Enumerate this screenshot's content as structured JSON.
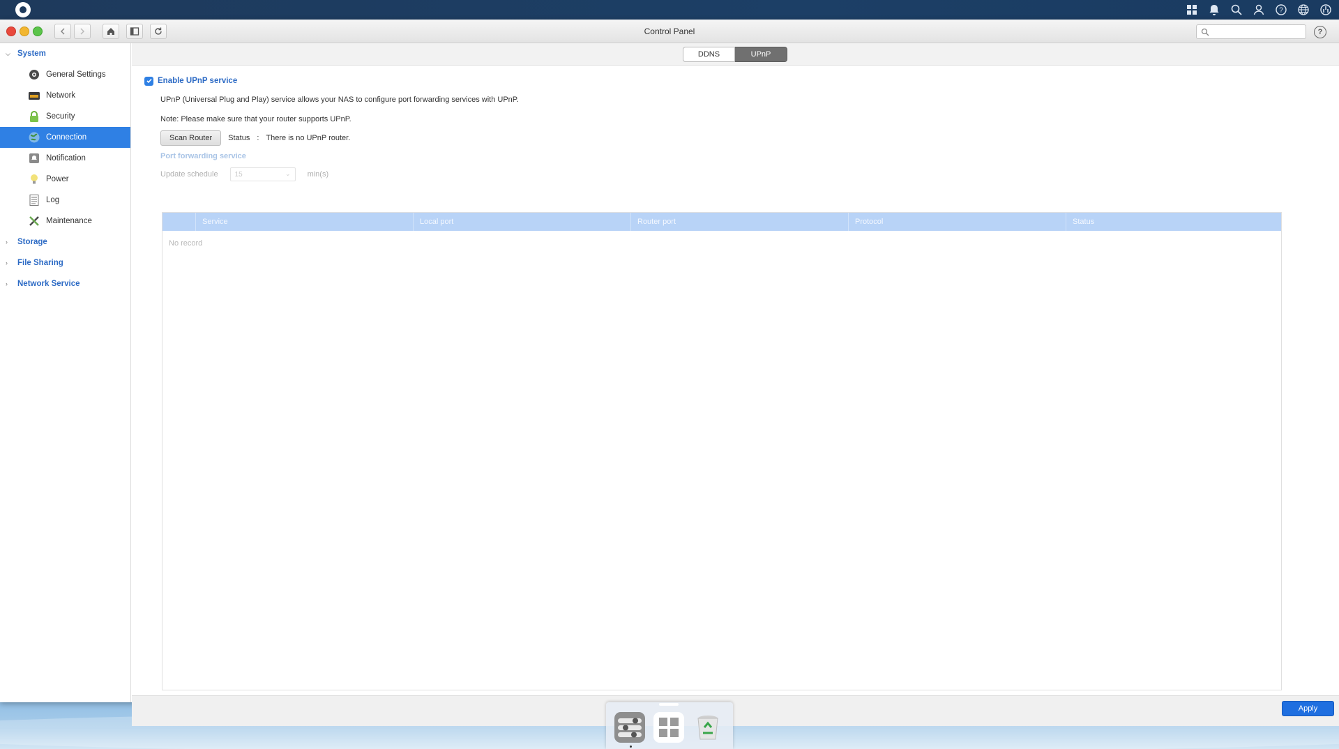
{
  "window": {
    "title": "Control Panel"
  },
  "search": {
    "placeholder": ""
  },
  "topbar": {
    "icons": [
      "apps-grid-icon",
      "bell-icon",
      "search-icon",
      "user-icon",
      "help-icon",
      "globe-icon",
      "dashboard-gauge-icon"
    ]
  },
  "sidebar": {
    "groups": [
      {
        "label": "System",
        "expanded": true,
        "items": [
          {
            "label": "General Settings",
            "icon": "settings-gear-icon"
          },
          {
            "label": "Network",
            "icon": "network-icon"
          },
          {
            "label": "Security",
            "icon": "lock-icon"
          },
          {
            "label": "Connection",
            "icon": "globe-connection-icon",
            "active": true
          },
          {
            "label": "Notification",
            "icon": "notification-icon"
          },
          {
            "label": "Power",
            "icon": "lightbulb-icon"
          },
          {
            "label": "Log",
            "icon": "log-icon"
          },
          {
            "label": "Maintenance",
            "icon": "tools-icon"
          }
        ]
      },
      {
        "label": "Storage",
        "expanded": false
      },
      {
        "label": "File Sharing",
        "expanded": false
      },
      {
        "label": "Network Service",
        "expanded": false
      }
    ]
  },
  "tabs": [
    {
      "label": "DDNS",
      "active": false
    },
    {
      "label": "UPnP",
      "active": true
    }
  ],
  "upnp": {
    "enable_label": "Enable UPnP service",
    "enabled": true,
    "description": "UPnP (Universal Plug and Play) service allows your NAS to configure port forwarding services with UPnP.",
    "note": "Note: Please make sure that your router supports UPnP.",
    "scan_button": "Scan Router",
    "status_label": "Status",
    "status_colon": ":",
    "status_value": "There is no UPnP router.",
    "port_forwarding_title": "Port forwarding service",
    "update_schedule_label": "Update schedule",
    "update_schedule_value": "15",
    "update_schedule_unit": "min(s)"
  },
  "grid": {
    "columns": [
      "Service",
      "Local port",
      "Router port",
      "Protocol",
      "Status"
    ],
    "rows": [],
    "empty_text": "No record"
  },
  "footer": {
    "apply_label": "Apply"
  },
  "colors": {
    "accent": "#2f80e4",
    "apply_button": "#1f6fe0",
    "grid_header": "#b8d3f7",
    "topbar": "#1e3a5c"
  }
}
